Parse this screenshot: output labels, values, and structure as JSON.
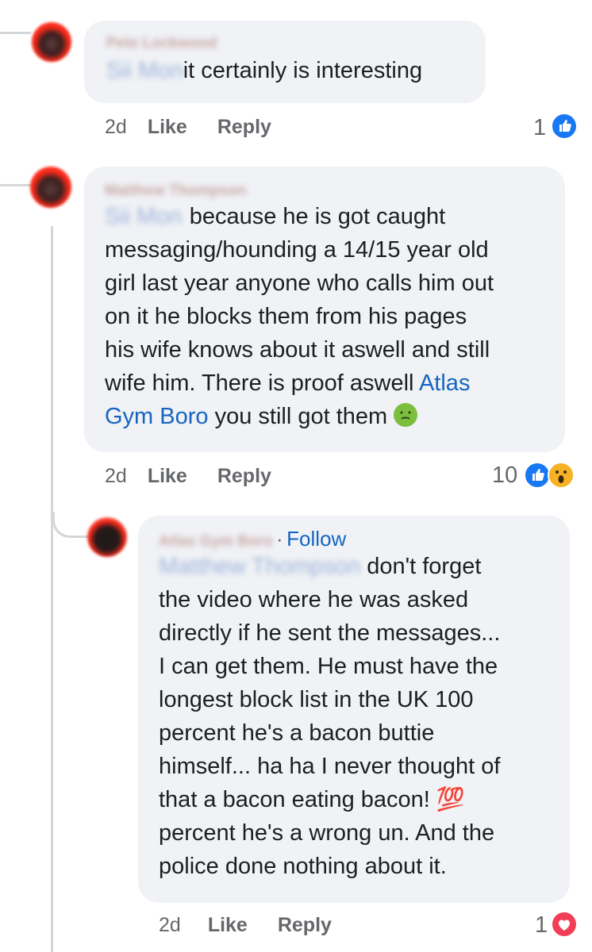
{
  "comments": [
    {
      "author": "Pete Lockwood",
      "mention": "Sii Mon",
      "text": "it certainly is interesting",
      "time": "2d",
      "like": "Like",
      "reply": "Reply",
      "reaction_count": "1"
    },
    {
      "author": "Matthew Thompson",
      "mention": "Sii Mon",
      "text_lines": [
        "because he is got caught",
        "messaging/hounding a 14/15 year old",
        "girl last year anyone who calls him out",
        "on it he blocks them from his pages",
        "his wife knows about it aswell and still",
        "wife him. There is proof aswell "
      ],
      "link_part1": "Atlas",
      "link_part2": "Gym Boro",
      "text_end": " you still got them",
      "time": "2d",
      "like": "Like",
      "reply": "Reply",
      "reaction_count": "10"
    },
    {
      "author": "Atlas Gym Boro",
      "follow": "Follow",
      "mention": "Matthew Thompson",
      "text_lines": [
        " don't forget",
        "the video where he was asked",
        "directly if he sent the messages...",
        "I can get them. He must have the",
        "longest block list in the UK 100",
        "percent he's a bacon buttie",
        "himself... ha ha I never thought of",
        "that a bacon eating bacon! 💯",
        "percent he's a wrong un. And the",
        "police done nothing about it."
      ],
      "time": "2d",
      "like": "Like",
      "reply": "Reply",
      "reaction_count": "1"
    }
  ],
  "icons": {
    "like_reaction": "thumbs-up-icon",
    "wow_reaction": "wow-face-icon",
    "love_reaction": "heart-icon",
    "sick_emoji": "nauseated-face-icon"
  },
  "colors": {
    "link": "#1565c0",
    "like_blue": "#1877f2",
    "love_red": "#f33e58",
    "bubble_bg": "#f0f2f5"
  }
}
